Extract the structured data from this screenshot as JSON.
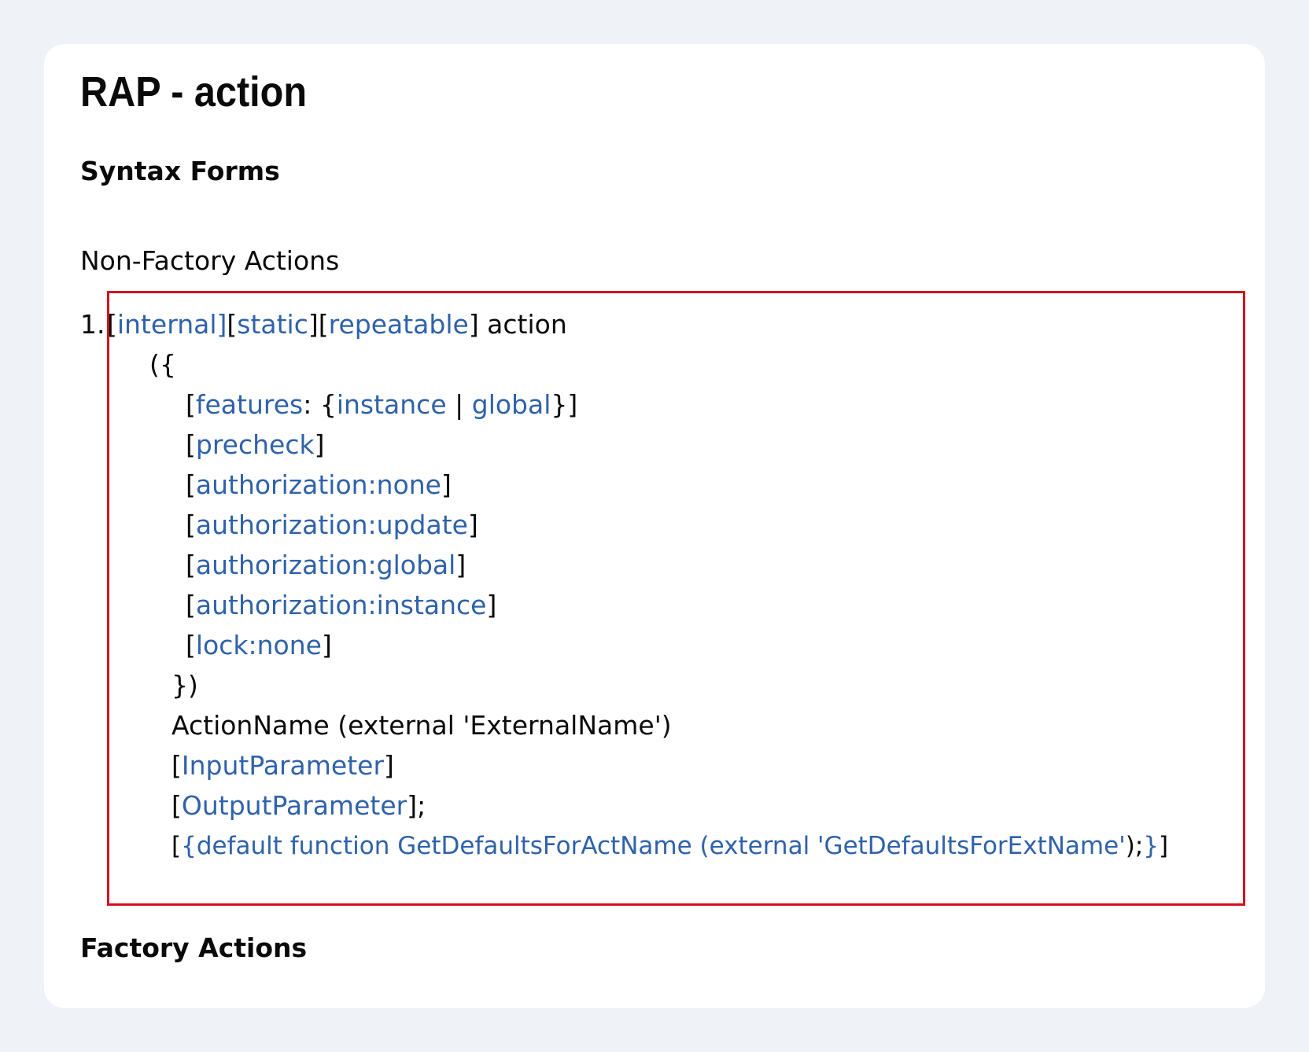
{
  "page": {
    "title": "RAP - action",
    "section_heading": "Syntax Forms",
    "subheading": "Non-Factory Actions",
    "factory_heading": "Factory Actions"
  },
  "syntax": {
    "list_number": "1.",
    "line1": {
      "open1": "[",
      "internal": "internal]",
      "open2": "[",
      "static": "static",
      "mid": "][",
      "repeatable": "repeatable",
      "close": "] action"
    },
    "line2": "({",
    "line3": {
      "open": "[",
      "features": "features",
      "colon": ": {",
      "instance": "instance",
      "pipe": " | ",
      "global": "global",
      "close": "}]"
    },
    "line4": {
      "open": "[",
      "kw": "precheck",
      "close": "]"
    },
    "line5": {
      "open": "[",
      "kw": "authorization:none",
      "close": "]"
    },
    "line6": {
      "open": "[",
      "kw": "authorization:update",
      "close": "]"
    },
    "line7": {
      "open": "[",
      "kw": "authorization:global",
      "close": "]"
    },
    "line8": {
      "open": "[",
      "kw": "authorization:instance",
      "close": "]"
    },
    "line9": {
      "open": "[",
      "kw": "lock:none",
      "close": "]"
    },
    "line10": "})",
    "line11": "ActionName (external 'ExternalName')",
    "line12": {
      "open": "[",
      "kw": "InputParameter",
      "close": "]"
    },
    "line13": {
      "open": "[",
      "kw": "OutputParameter",
      "close": "];"
    },
    "line14": {
      "open": "[",
      "kw": "{default function GetDefaultsForActName (external 'GetDefaultsForExtName'",
      "mid": ");",
      "kw2": "}",
      "close": "]"
    }
  },
  "colors": {
    "keyword": "#2f62aa",
    "highlight_border": "#d3141d",
    "page_background": "#eff2f7",
    "card_background": "#ffffff"
  }
}
